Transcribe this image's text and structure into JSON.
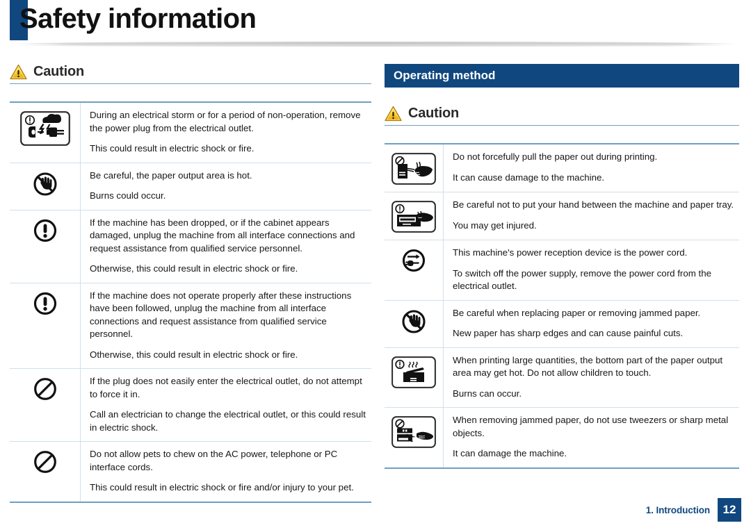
{
  "header": {
    "title": "Safety information",
    "accent_color": "#10477f"
  },
  "footer": {
    "chapter_label": "1. Introduction",
    "page_number": "12"
  },
  "left_column": {
    "caution_heading": "Caution",
    "warning_icon": "warning-triangle-icon",
    "rows": [
      {
        "icon": "unplug-during-storm-icon",
        "lines": [
          "During an electrical storm or for a period of non-operation, remove the power plug from the electrical outlet.",
          "This could result in electric shock or fire."
        ]
      },
      {
        "icon": "no-touch-hot-surface-icon",
        "lines": [
          "Be careful, the paper output area is hot.",
          "Burns could occur."
        ]
      },
      {
        "icon": "exclamation-circle-icon",
        "lines": [
          "If the machine has been dropped, or if the cabinet appears damaged, unplug the machine from all interface connections and request assistance from qualified service personnel.",
          "Otherwise, this could result in electric shock or fire."
        ]
      },
      {
        "icon": "exclamation-circle-icon",
        "lines": [
          "If the machine does not operate properly after these instructions have been followed, unplug the machine from all interface connections and request assistance from qualified service personnel.",
          "Otherwise, this could result in electric shock or fire."
        ]
      },
      {
        "icon": "prohibition-circle-icon",
        "lines": [
          "If the plug does not easily enter the electrical outlet, do not attempt to force it in.",
          "Call an electrician to change the electrical outlet, or this could result in electric shock."
        ]
      },
      {
        "icon": "prohibition-circle-icon",
        "lines": [
          "Do not allow pets to chew on the AC power, telephone or PC interface cords.",
          "This could result in electric shock or fire and/or injury to your pet."
        ]
      }
    ]
  },
  "right_column": {
    "section_title": "Operating method",
    "caution_heading": "Caution",
    "warning_icon": "warning-triangle-icon",
    "rows": [
      {
        "icon": "do-not-pull-paper-icon",
        "lines": [
          "Do not forcefully pull the paper out during printing.",
          "It can cause damage to the machine."
        ]
      },
      {
        "icon": "hand-caught-in-tray-icon",
        "lines": [
          "Be careful not to put your hand between the machine and paper tray.",
          "You may get injured."
        ]
      },
      {
        "icon": "power-cord-circle-icon",
        "lines": [
          "This machine's power reception device is the power cord.",
          "To switch off the power supply, remove the power cord from the electrical outlet."
        ]
      },
      {
        "icon": "no-touch-hot-surface-icon",
        "lines": [
          "Be careful when replacing paper or removing jammed paper.",
          "New paper has sharp edges and can cause painful cuts."
        ]
      },
      {
        "icon": "hot-output-area-icon",
        "lines": [
          "When printing large quantities, the bottom part of the paper output area may get hot. Do not allow children to touch.",
          "Burns can occur."
        ]
      },
      {
        "icon": "no-tweezers-icon",
        "lines": [
          "When removing jammed paper, do not use tweezers or sharp metal objects.",
          "It can damage the machine."
        ]
      }
    ]
  },
  "colors": {
    "brand_blue": "#10477f",
    "rule_blue": "#6d9fc4",
    "row_divider": "#cfe0ec"
  }
}
